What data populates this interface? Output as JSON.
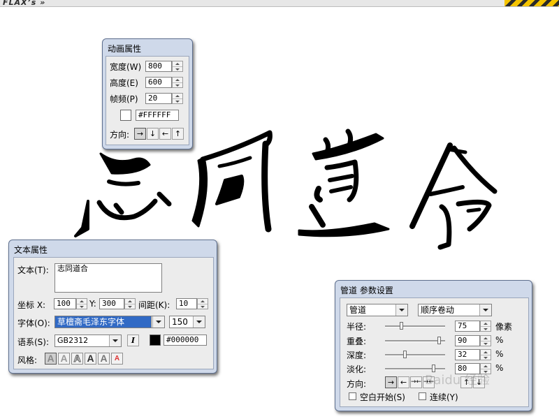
{
  "app": {
    "logo_text": "FLAX’s »"
  },
  "canvas": {
    "calligraphy_text": "志同道合"
  },
  "anim_panel": {
    "title": "动画属性",
    "width_label": "宽度(W)",
    "width_value": "800",
    "height_label": "高度(E)",
    "height_value": "600",
    "fps_label": "帧频(P)",
    "fps_value": "20",
    "bg_color": "#FFFFFF",
    "direction_label": "方向:",
    "direction_buttons": [
      "→",
      "↓",
      "←",
      "↑"
    ]
  },
  "text_panel": {
    "title": "文本属性",
    "text_label": "文本(T):",
    "text_value": "志同道合",
    "coord_label": "坐标 X:",
    "x_value": "100",
    "y_label": "Y:",
    "y_value": "300",
    "spacing_label": "间距(K):",
    "spacing_value": "10",
    "font_label": "字体(O):",
    "font_value": "草檀斋毛泽东字体",
    "font_size": "150",
    "lang_label": "语系(S):",
    "lang_value": "GB2312",
    "italic_label": "I",
    "text_color": "#000000",
    "style_label": "风格:",
    "style_icons": [
      "A",
      "A",
      "A",
      "A",
      "A",
      "A"
    ]
  },
  "pipe_panel": {
    "title": "管道 参数设置",
    "type_value": "管道",
    "mode_value": "顺序卷动",
    "radius_label": "半径:",
    "radius_value": "75",
    "radius_unit": "像素",
    "radius_level": 0.27,
    "overlap_label": "重叠:",
    "overlap_value": "90",
    "overlap_level": 0.9,
    "depth_label": "深度:",
    "depth_value": "32",
    "depth_level": 0.32,
    "fade_label": "淡化:",
    "fade_value": "80",
    "fade_level": 0.8,
    "percent_unit": "%",
    "direction_label": "方向:",
    "direction_buttons": [
      "→",
      "←",
      "→←",
      "→←",
      "↑",
      "↓"
    ],
    "blank_start_label": "空白开始(S)",
    "continuous_label": "连续(Y)"
  },
  "watermark": "Baidu 经验"
}
